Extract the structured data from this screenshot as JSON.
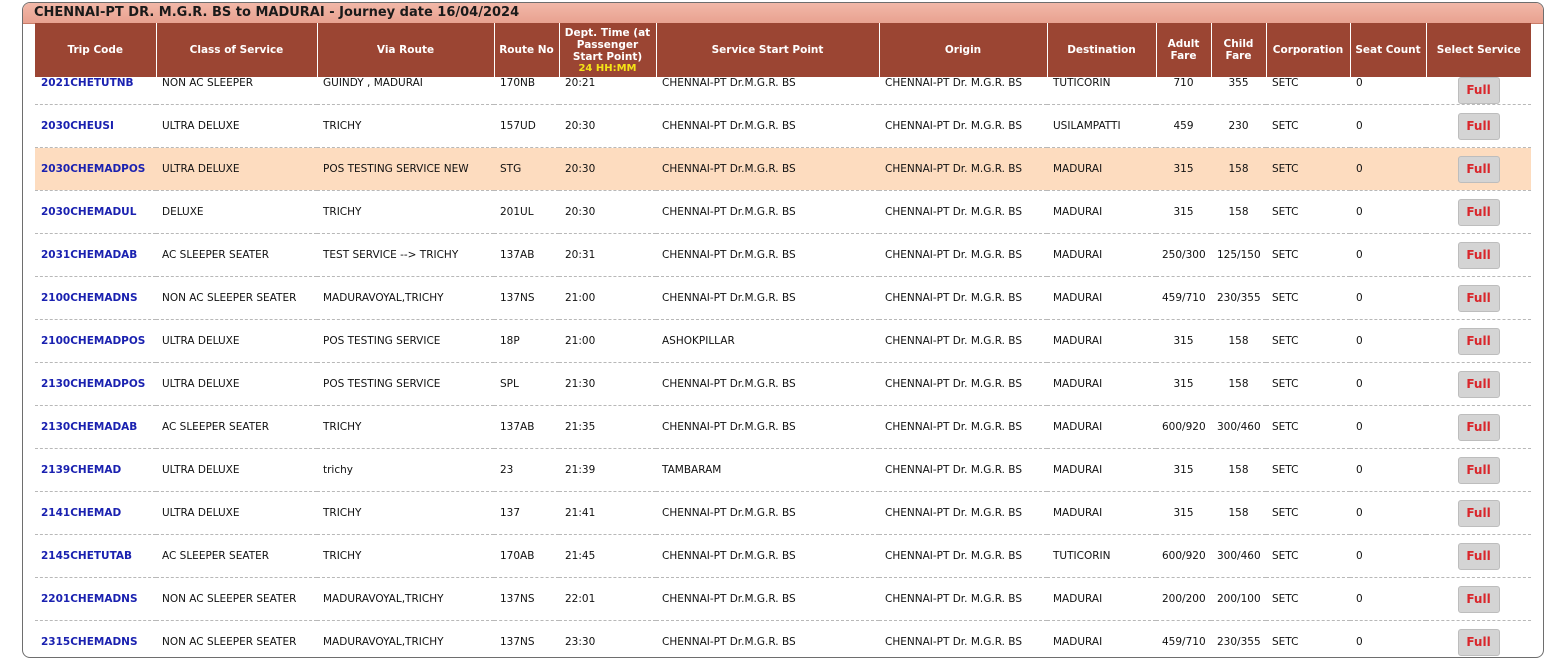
{
  "title": "CHENNAI-PT DR. M.G.R. BS to MADURAI - Journey date 16/04/2024",
  "headers": {
    "trip_code": "Trip Code",
    "class_of_service": "Class of Service",
    "via_route": "Via Route",
    "route_no": "Route No",
    "dept_time": "Dept. Time (at Passenger Start Point)",
    "dept_time_format": "24 HH:MM",
    "service_start_point": "Service Start Point",
    "origin": "Origin",
    "destination": "Destination",
    "adult_fare": "Adult Fare",
    "child_fare": "Child Fare",
    "corporation": "Corporation",
    "seat_count": "Seat Count",
    "select_service": "Select Service"
  },
  "rows": [
    {
      "trip_code": "2021CHETUTNB",
      "class": "NON AC SLEEPER",
      "via": "GUINDY , MADURAI",
      "route_no": "170NB",
      "time": "20:21",
      "start_point": "CHENNAI-PT Dr.M.G.R. BS",
      "origin": "CHENNAI-PT Dr. M.G.R. BS",
      "destination": "TUTICORIN",
      "adult": "710",
      "child": "355",
      "corp": "SETC",
      "seats": "0",
      "action": "Full"
    },
    {
      "trip_code": "2030CHEUSI",
      "class": "ULTRA DELUXE",
      "via": "TRICHY",
      "route_no": "157UD",
      "time": "20:30",
      "start_point": "CHENNAI-PT Dr.M.G.R. BS",
      "origin": "CHENNAI-PT Dr. M.G.R. BS",
      "destination": "USILAMPATTI",
      "adult": "459",
      "child": "230",
      "corp": "SETC",
      "seats": "0",
      "action": "Full"
    },
    {
      "trip_code": "2030CHEMADPOS",
      "class": "ULTRA DELUXE",
      "via": "POS TESTING SERVICE NEW",
      "route_no": "STG",
      "time": "20:30",
      "start_point": "CHENNAI-PT Dr.M.G.R. BS",
      "origin": "CHENNAI-PT Dr. M.G.R. BS",
      "destination": "MADURAI",
      "adult": "315",
      "child": "158",
      "corp": "SETC",
      "seats": "0",
      "action": "Full"
    },
    {
      "trip_code": "2030CHEMADUL",
      "class": "DELUXE",
      "via": "TRICHY",
      "route_no": "201UL",
      "time": "20:30",
      "start_point": "CHENNAI-PT Dr.M.G.R. BS",
      "origin": "CHENNAI-PT Dr. M.G.R. BS",
      "destination": "MADURAI",
      "adult": "315",
      "child": "158",
      "corp": "SETC",
      "seats": "0",
      "action": "Full"
    },
    {
      "trip_code": "2031CHEMADAB",
      "class": "AC SLEEPER SEATER",
      "via": "TEST SERVICE --> TRICHY",
      "route_no": "137AB",
      "time": "20:31",
      "start_point": "CHENNAI-PT Dr.M.G.R. BS",
      "origin": "CHENNAI-PT Dr. M.G.R. BS",
      "destination": "MADURAI",
      "adult": "250/300",
      "child": "125/150",
      "corp": "SETC",
      "seats": "0",
      "action": "Full"
    },
    {
      "trip_code": "2100CHEMADNS",
      "class": "NON AC SLEEPER SEATER",
      "via": "MADURAVOYAL,TRICHY",
      "route_no": "137NS",
      "time": "21:00",
      "start_point": "CHENNAI-PT Dr.M.G.R. BS",
      "origin": "CHENNAI-PT Dr. M.G.R. BS",
      "destination": "MADURAI",
      "adult": "459/710",
      "child": "230/355",
      "corp": "SETC",
      "seats": "0",
      "action": "Full"
    },
    {
      "trip_code": "2100CHEMADPOS",
      "class": "ULTRA DELUXE",
      "via": "POS TESTING SERVICE",
      "route_no": "18P",
      "time": "21:00",
      "start_point": "ASHOKPILLAR",
      "origin": "CHENNAI-PT Dr. M.G.R. BS",
      "destination": "MADURAI",
      "adult": "315",
      "child": "158",
      "corp": "SETC",
      "seats": "0",
      "action": "Full"
    },
    {
      "trip_code": "2130CHEMADPOS",
      "class": "ULTRA DELUXE",
      "via": "POS TESTING SERVICE",
      "route_no": "SPL",
      "time": "21:30",
      "start_point": "CHENNAI-PT Dr.M.G.R. BS",
      "origin": "CHENNAI-PT Dr. M.G.R. BS",
      "destination": "MADURAI",
      "adult": "315",
      "child": "158",
      "corp": "SETC",
      "seats": "0",
      "action": "Full"
    },
    {
      "trip_code": "2130CHEMADAB",
      "class": "AC SLEEPER SEATER",
      "via": "TRICHY",
      "route_no": "137AB",
      "time": "21:35",
      "start_point": "CHENNAI-PT Dr.M.G.R. BS",
      "origin": "CHENNAI-PT Dr. M.G.R. BS",
      "destination": "MADURAI",
      "adult": "600/920",
      "child": "300/460",
      "corp": "SETC",
      "seats": "0",
      "action": "Full"
    },
    {
      "trip_code": "2139CHEMAD",
      "class": "ULTRA DELUXE",
      "via": "trichy",
      "route_no": "23",
      "time": "21:39",
      "start_point": "TAMBARAM",
      "origin": "CHENNAI-PT Dr. M.G.R. BS",
      "destination": "MADURAI",
      "adult": "315",
      "child": "158",
      "corp": "SETC",
      "seats": "0",
      "action": "Full"
    },
    {
      "trip_code": "2141CHEMAD",
      "class": "ULTRA DELUXE",
      "via": "TRICHY",
      "route_no": "137",
      "time": "21:41",
      "start_point": "CHENNAI-PT Dr.M.G.R. BS",
      "origin": "CHENNAI-PT Dr. M.G.R. BS",
      "destination": "MADURAI",
      "adult": "315",
      "child": "158",
      "corp": "SETC",
      "seats": "0",
      "action": "Full"
    },
    {
      "trip_code": "2145CHETUTAB",
      "class": "AC SLEEPER SEATER",
      "via": "TRICHY",
      "route_no": "170AB",
      "time": "21:45",
      "start_point": "CHENNAI-PT Dr.M.G.R. BS",
      "origin": "CHENNAI-PT Dr. M.G.R. BS",
      "destination": "TUTICORIN",
      "adult": "600/920",
      "child": "300/460",
      "corp": "SETC",
      "seats": "0",
      "action": "Full"
    },
    {
      "trip_code": "2201CHEMADNS",
      "class": "NON AC SLEEPER SEATER",
      "via": "MADURAVOYAL,TRICHY",
      "route_no": "137NS",
      "time": "22:01",
      "start_point": "CHENNAI-PT Dr.M.G.R. BS",
      "origin": "CHENNAI-PT Dr. M.G.R. BS",
      "destination": "MADURAI",
      "adult": "200/200",
      "child": "200/100",
      "corp": "SETC",
      "seats": "0",
      "action": "Full"
    },
    {
      "trip_code": "2315CHEMADNS",
      "class": "NON AC SLEEPER SEATER",
      "via": "MADURAVOYAL,TRICHY",
      "route_no": "137NS",
      "time": "23:30",
      "start_point": "CHENNAI-PT Dr.M.G.R. BS",
      "origin": "CHENNAI-PT Dr. M.G.R. BS",
      "destination": "MADURAI",
      "adult": "459/710",
      "child": "230/355",
      "corp": "SETC",
      "seats": "0",
      "action": "Full"
    }
  ],
  "highlighted_row": 2,
  "colors": {
    "header_bg": "#9b4533",
    "title_bar": "#e8a190",
    "highlight_row": "#fddcbf",
    "trip_code_link": "#1a21b0",
    "full_text": "#d9262b",
    "time_format": "#f4e416"
  }
}
